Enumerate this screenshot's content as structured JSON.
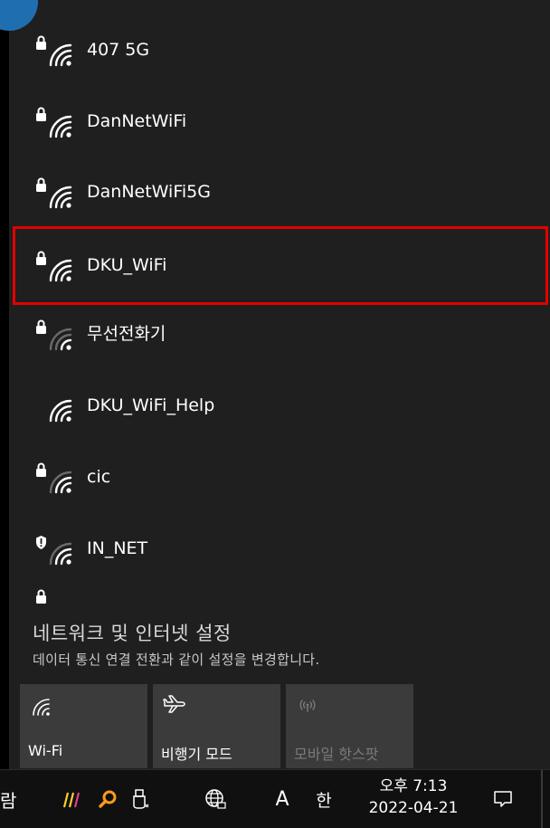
{
  "networks": [
    {
      "name": "407 5G",
      "icon": "wifi-lock-icon"
    },
    {
      "name": "DanNetWiFi",
      "icon": "wifi-lock-icon"
    },
    {
      "name": "DanNetWiFi5G",
      "icon": "wifi-lock-icon"
    },
    {
      "name": "DKU_WiFi",
      "icon": "wifi-lock-icon",
      "highlight_color": "#e30000"
    },
    {
      "name": "무선전화기",
      "icon": "wifi-lock-icon"
    },
    {
      "name": "DKU_WiFi_Help",
      "icon": "wifi-open-icon"
    },
    {
      "name": "cic",
      "icon": "wifi-lock-icon"
    },
    {
      "name": "IN_NET",
      "icon": "wifi-shield-icon"
    }
  ],
  "settings": {
    "title": "네트워크 및 인터넷 설정",
    "description": "데이터 통신 연결 전환과 같이 설정을 변경합니다."
  },
  "quick_actions": [
    {
      "label": "Wi-Fi",
      "icon": "wifi-icon",
      "enabled": true
    },
    {
      "label": "비행기 모드",
      "icon": "airplane-icon",
      "enabled": true
    },
    {
      "label": "모바일 핫스팟",
      "icon": "hotspot-icon",
      "enabled": false
    }
  ],
  "taskbar": {
    "left_text": "람",
    "input_mode": "A",
    "ime": "한",
    "time": "오후 7:13",
    "date": "2022-04-21"
  },
  "colors": {
    "flyout_bg": "#1f1f1f",
    "tile_bg": "#3b3b3b",
    "highlight": "#e30000",
    "taskbar_bg": "#101010"
  }
}
